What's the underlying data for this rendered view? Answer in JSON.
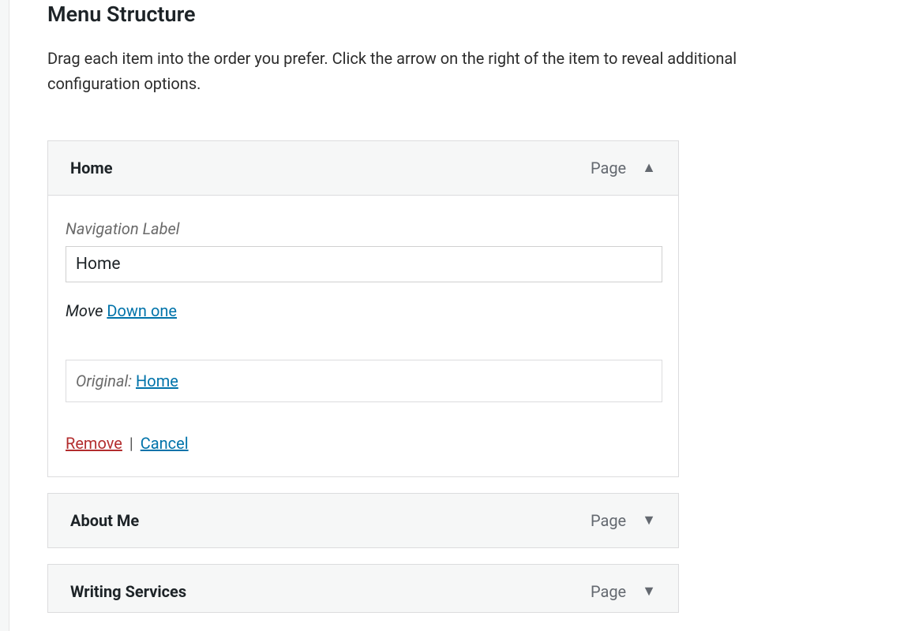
{
  "section": {
    "title": "Menu Structure",
    "description": "Drag each item into the order you prefer. Click the arrow on the right of the item to reveal additional configuration options."
  },
  "menu_items": [
    {
      "title": "Home",
      "type": "Page",
      "expanded": true,
      "nav_label_text": "Navigation Label",
      "nav_label_value": "Home",
      "move_label": "Move",
      "move_down": "Down one",
      "original_label": "Original:",
      "original_value": "Home",
      "remove": "Remove",
      "cancel": "Cancel",
      "separator": "|"
    },
    {
      "title": "About Me",
      "type": "Page",
      "expanded": false
    },
    {
      "title": "Writing Services",
      "type": "Page",
      "expanded": false
    }
  ]
}
